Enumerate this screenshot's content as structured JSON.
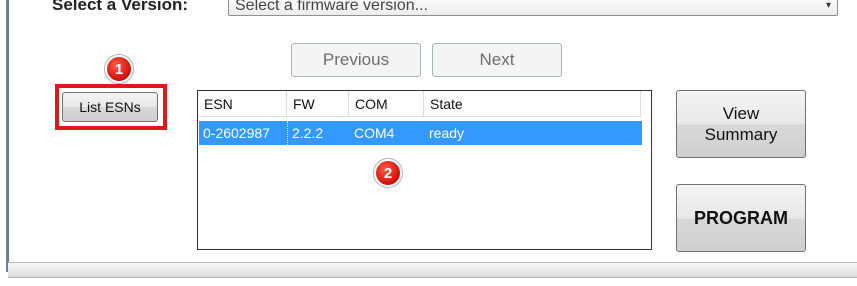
{
  "version": {
    "label": "Select a Version:",
    "select_value": "Select a firmware version..."
  },
  "nav": {
    "previous_label": "Previous",
    "next_label": "Next"
  },
  "list_esns_label": "List ESNs",
  "badges": [
    "1",
    "2"
  ],
  "table": {
    "columns": [
      "ESN",
      "FW",
      "COM",
      "State"
    ],
    "rows": [
      {
        "esn": "0-2602987",
        "fw": "2.2.2",
        "com": "COM4",
        "state": "ready"
      }
    ]
  },
  "view_summary": {
    "line1": "View",
    "line2": "Summary"
  },
  "program_label": "PROGRAM",
  "colors": {
    "selection": "#3399ff",
    "highlight": "#e2161e",
    "badge": "#d3140b"
  }
}
